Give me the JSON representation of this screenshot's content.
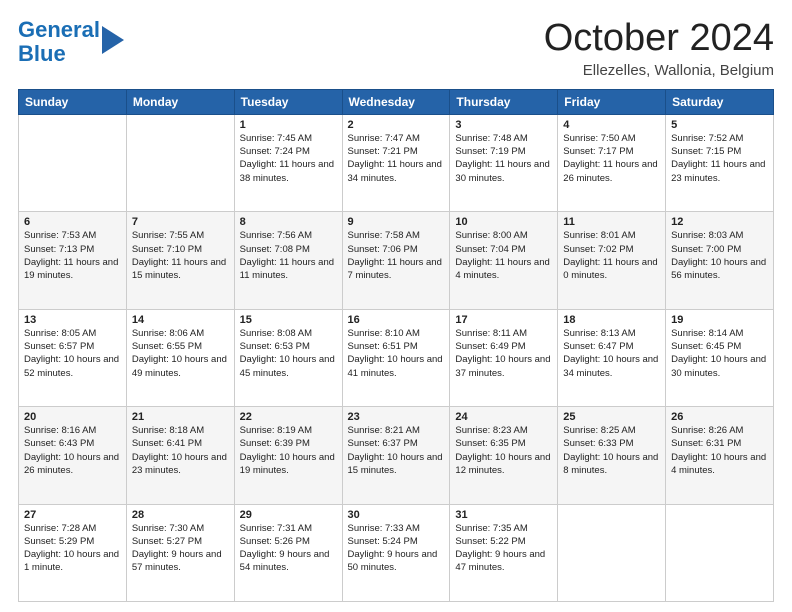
{
  "header": {
    "logo_line1": "General",
    "logo_line2": "Blue",
    "month": "October 2024",
    "location": "Ellezelles, Wallonia, Belgium"
  },
  "weekdays": [
    "Sunday",
    "Monday",
    "Tuesday",
    "Wednesday",
    "Thursday",
    "Friday",
    "Saturday"
  ],
  "weeks": [
    [
      {
        "day": "",
        "sunrise": "",
        "sunset": "",
        "daylight": ""
      },
      {
        "day": "",
        "sunrise": "",
        "sunset": "",
        "daylight": ""
      },
      {
        "day": "1",
        "sunrise": "Sunrise: 7:45 AM",
        "sunset": "Sunset: 7:24 PM",
        "daylight": "Daylight: 11 hours and 38 minutes."
      },
      {
        "day": "2",
        "sunrise": "Sunrise: 7:47 AM",
        "sunset": "Sunset: 7:21 PM",
        "daylight": "Daylight: 11 hours and 34 minutes."
      },
      {
        "day": "3",
        "sunrise": "Sunrise: 7:48 AM",
        "sunset": "Sunset: 7:19 PM",
        "daylight": "Daylight: 11 hours and 30 minutes."
      },
      {
        "day": "4",
        "sunrise": "Sunrise: 7:50 AM",
        "sunset": "Sunset: 7:17 PM",
        "daylight": "Daylight: 11 hours and 26 minutes."
      },
      {
        "day": "5",
        "sunrise": "Sunrise: 7:52 AM",
        "sunset": "Sunset: 7:15 PM",
        "daylight": "Daylight: 11 hours and 23 minutes."
      }
    ],
    [
      {
        "day": "6",
        "sunrise": "Sunrise: 7:53 AM",
        "sunset": "Sunset: 7:13 PM",
        "daylight": "Daylight: 11 hours and 19 minutes."
      },
      {
        "day": "7",
        "sunrise": "Sunrise: 7:55 AM",
        "sunset": "Sunset: 7:10 PM",
        "daylight": "Daylight: 11 hours and 15 minutes."
      },
      {
        "day": "8",
        "sunrise": "Sunrise: 7:56 AM",
        "sunset": "Sunset: 7:08 PM",
        "daylight": "Daylight: 11 hours and 11 minutes."
      },
      {
        "day": "9",
        "sunrise": "Sunrise: 7:58 AM",
        "sunset": "Sunset: 7:06 PM",
        "daylight": "Daylight: 11 hours and 7 minutes."
      },
      {
        "day": "10",
        "sunrise": "Sunrise: 8:00 AM",
        "sunset": "Sunset: 7:04 PM",
        "daylight": "Daylight: 11 hours and 4 minutes."
      },
      {
        "day": "11",
        "sunrise": "Sunrise: 8:01 AM",
        "sunset": "Sunset: 7:02 PM",
        "daylight": "Daylight: 11 hours and 0 minutes."
      },
      {
        "day": "12",
        "sunrise": "Sunrise: 8:03 AM",
        "sunset": "Sunset: 7:00 PM",
        "daylight": "Daylight: 10 hours and 56 minutes."
      }
    ],
    [
      {
        "day": "13",
        "sunrise": "Sunrise: 8:05 AM",
        "sunset": "Sunset: 6:57 PM",
        "daylight": "Daylight: 10 hours and 52 minutes."
      },
      {
        "day": "14",
        "sunrise": "Sunrise: 8:06 AM",
        "sunset": "Sunset: 6:55 PM",
        "daylight": "Daylight: 10 hours and 49 minutes."
      },
      {
        "day": "15",
        "sunrise": "Sunrise: 8:08 AM",
        "sunset": "Sunset: 6:53 PM",
        "daylight": "Daylight: 10 hours and 45 minutes."
      },
      {
        "day": "16",
        "sunrise": "Sunrise: 8:10 AM",
        "sunset": "Sunset: 6:51 PM",
        "daylight": "Daylight: 10 hours and 41 minutes."
      },
      {
        "day": "17",
        "sunrise": "Sunrise: 8:11 AM",
        "sunset": "Sunset: 6:49 PM",
        "daylight": "Daylight: 10 hours and 37 minutes."
      },
      {
        "day": "18",
        "sunrise": "Sunrise: 8:13 AM",
        "sunset": "Sunset: 6:47 PM",
        "daylight": "Daylight: 10 hours and 34 minutes."
      },
      {
        "day": "19",
        "sunrise": "Sunrise: 8:14 AM",
        "sunset": "Sunset: 6:45 PM",
        "daylight": "Daylight: 10 hours and 30 minutes."
      }
    ],
    [
      {
        "day": "20",
        "sunrise": "Sunrise: 8:16 AM",
        "sunset": "Sunset: 6:43 PM",
        "daylight": "Daylight: 10 hours and 26 minutes."
      },
      {
        "day": "21",
        "sunrise": "Sunrise: 8:18 AM",
        "sunset": "Sunset: 6:41 PM",
        "daylight": "Daylight: 10 hours and 23 minutes."
      },
      {
        "day": "22",
        "sunrise": "Sunrise: 8:19 AM",
        "sunset": "Sunset: 6:39 PM",
        "daylight": "Daylight: 10 hours and 19 minutes."
      },
      {
        "day": "23",
        "sunrise": "Sunrise: 8:21 AM",
        "sunset": "Sunset: 6:37 PM",
        "daylight": "Daylight: 10 hours and 15 minutes."
      },
      {
        "day": "24",
        "sunrise": "Sunrise: 8:23 AM",
        "sunset": "Sunset: 6:35 PM",
        "daylight": "Daylight: 10 hours and 12 minutes."
      },
      {
        "day": "25",
        "sunrise": "Sunrise: 8:25 AM",
        "sunset": "Sunset: 6:33 PM",
        "daylight": "Daylight: 10 hours and 8 minutes."
      },
      {
        "day": "26",
        "sunrise": "Sunrise: 8:26 AM",
        "sunset": "Sunset: 6:31 PM",
        "daylight": "Daylight: 10 hours and 4 minutes."
      }
    ],
    [
      {
        "day": "27",
        "sunrise": "Sunrise: 7:28 AM",
        "sunset": "Sunset: 5:29 PM",
        "daylight": "Daylight: 10 hours and 1 minute."
      },
      {
        "day": "28",
        "sunrise": "Sunrise: 7:30 AM",
        "sunset": "Sunset: 5:27 PM",
        "daylight": "Daylight: 9 hours and 57 minutes."
      },
      {
        "day": "29",
        "sunrise": "Sunrise: 7:31 AM",
        "sunset": "Sunset: 5:26 PM",
        "daylight": "Daylight: 9 hours and 54 minutes."
      },
      {
        "day": "30",
        "sunrise": "Sunrise: 7:33 AM",
        "sunset": "Sunset: 5:24 PM",
        "daylight": "Daylight: 9 hours and 50 minutes."
      },
      {
        "day": "31",
        "sunrise": "Sunrise: 7:35 AM",
        "sunset": "Sunset: 5:22 PM",
        "daylight": "Daylight: 9 hours and 47 minutes."
      },
      {
        "day": "",
        "sunrise": "",
        "sunset": "",
        "daylight": ""
      },
      {
        "day": "",
        "sunrise": "",
        "sunset": "",
        "daylight": ""
      }
    ]
  ]
}
